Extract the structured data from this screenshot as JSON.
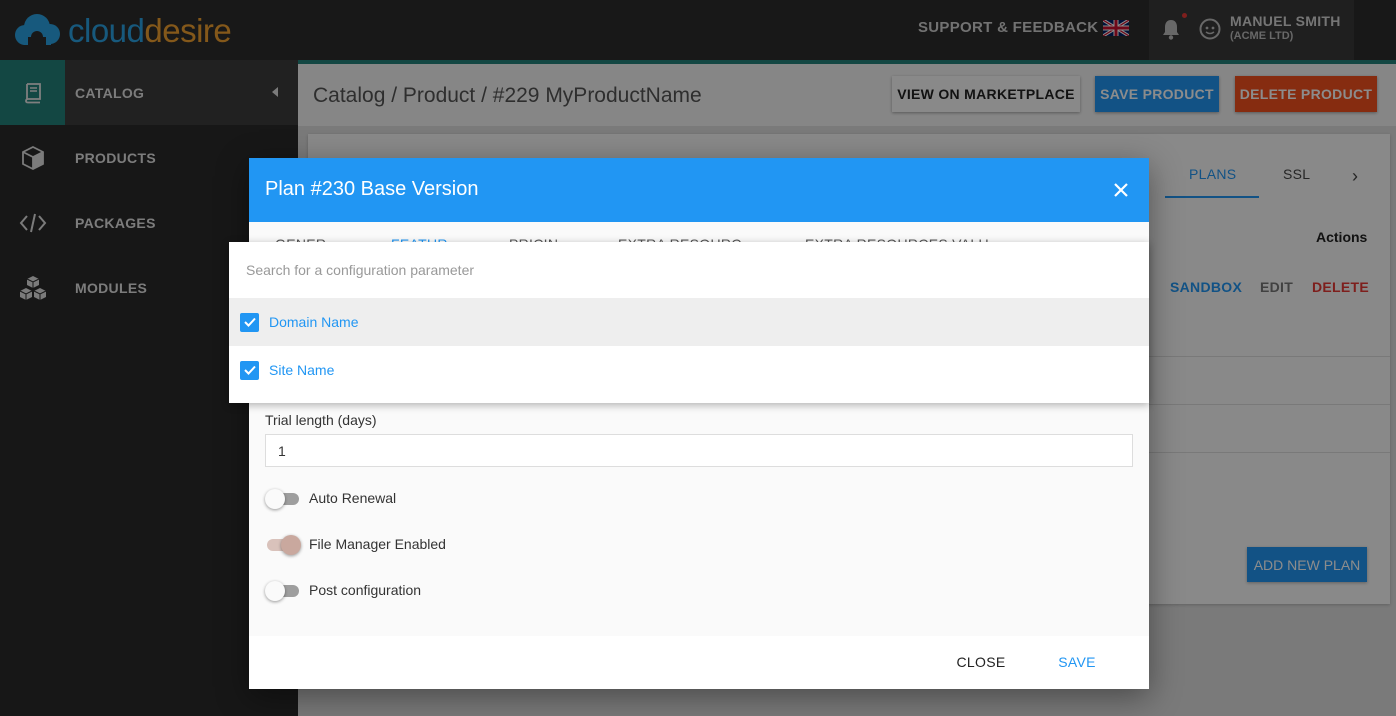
{
  "topbar": {
    "logo_part1": "cloud",
    "logo_part2": "esire",
    "support_label": "SUPPORT & FEEDBACK",
    "user_name": "MANUEL SMITH",
    "user_company": "(ACME LTD)"
  },
  "sidebar": {
    "items": [
      {
        "label": "CATALOG",
        "icon": "book-icon"
      },
      {
        "label": "PRODUCTS",
        "icon": "box-icon"
      },
      {
        "label": "PACKAGES",
        "icon": "code-icon"
      },
      {
        "label": "MODULES",
        "icon": "cubes-icon"
      }
    ]
  },
  "page": {
    "breadcrumb": "Catalog / Product / #229 MyProductName",
    "view_button": "VIEW ON MARKETPLACE",
    "save_button": "SAVE PRODUCT",
    "delete_button": "DELETE PRODUCT"
  },
  "card": {
    "tabs": [
      "PLANS",
      "SSL"
    ],
    "actions_header": "Actions",
    "row_actions": {
      "sandbox": "SANDBOX",
      "edit": "EDIT",
      "delete": "DELETE"
    },
    "add_plan_button": "ADD NEW PLAN"
  },
  "modal": {
    "title": "Plan #230 Base Version",
    "tabs": [
      "GENER",
      "FEATUR",
      "PRICIN",
      "EXTRA RESOURC",
      "EXTRA RESOURCES VALU"
    ],
    "active_tab": "FEATUR",
    "trial_label": "Trial length (days)",
    "trial_value": "1",
    "toggles": [
      {
        "label": "Auto Renewal",
        "on": false
      },
      {
        "label": "File Manager Enabled",
        "on": true
      },
      {
        "label": "Post configuration",
        "on": false
      }
    ],
    "close_button": "CLOSE",
    "save_button": "SAVE"
  },
  "dropdown": {
    "search_placeholder": "Search for a configuration parameter",
    "options": [
      {
        "label": "Domain Name",
        "checked": true
      },
      {
        "label": "Site Name",
        "checked": true
      }
    ]
  },
  "colors": {
    "primary": "#2196f3",
    "danger": "#f4511e",
    "accent": "#23827a",
    "topbar": "#2d2d2d"
  }
}
